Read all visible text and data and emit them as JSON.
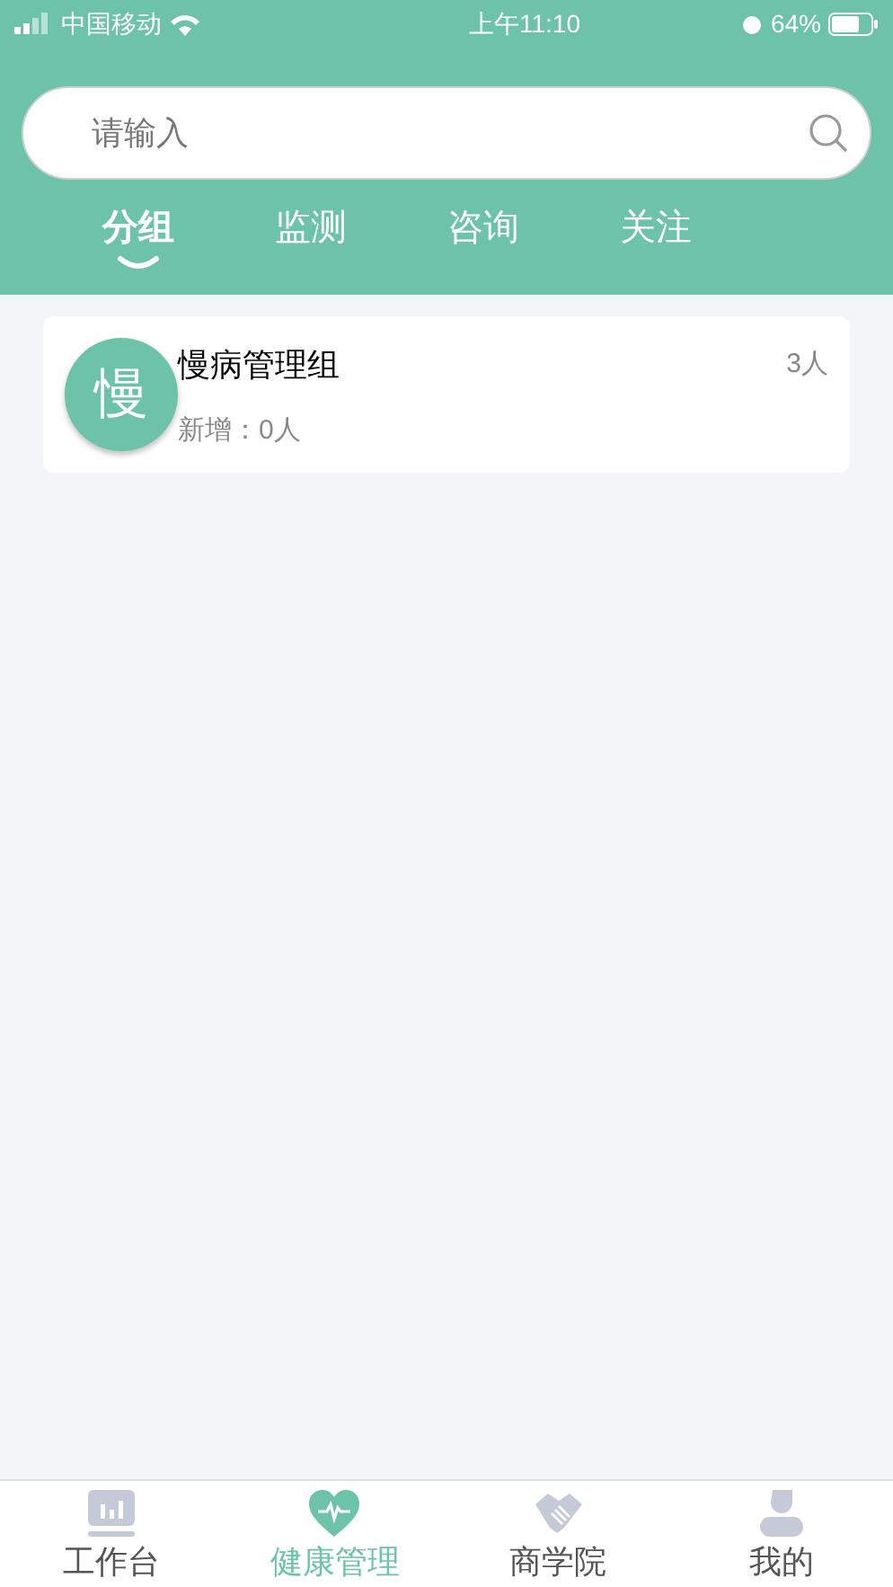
{
  "status_bar": {
    "carrier": "中国移动",
    "time": "上午11:10",
    "battery": "64%"
  },
  "search": {
    "placeholder": "请输入"
  },
  "tabs": [
    {
      "label": "分组",
      "selected": true
    },
    {
      "label": "监测",
      "selected": false
    },
    {
      "label": "咨询",
      "selected": false
    },
    {
      "label": "关注",
      "selected": false
    }
  ],
  "groups": [
    {
      "avatar": "慢",
      "name": "慢病管理组",
      "count": "3人",
      "new": "新增：0人"
    }
  ],
  "nav": [
    {
      "label": "工作台",
      "kind": "chart",
      "selected": false
    },
    {
      "label": "健康管理",
      "kind": "heart",
      "selected": true
    },
    {
      "label": "商学院",
      "kind": "handshake",
      "selected": false
    },
    {
      "label": "我的",
      "kind": "person",
      "selected": false
    }
  ]
}
